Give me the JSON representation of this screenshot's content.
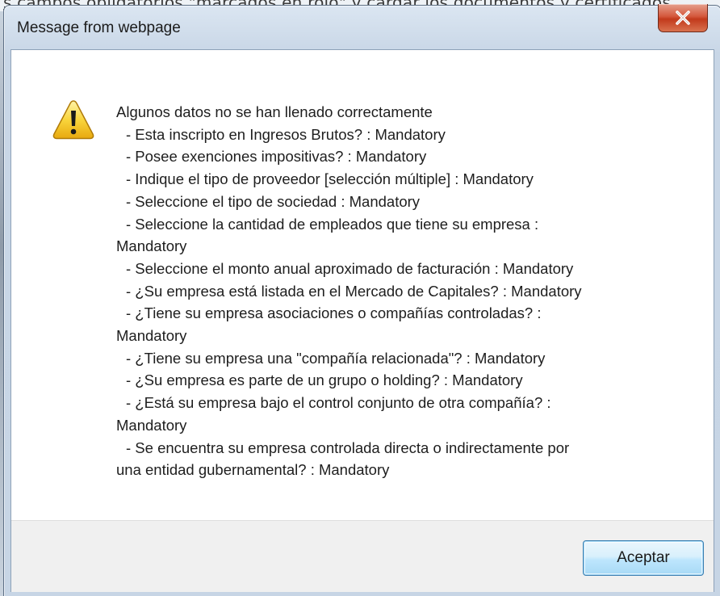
{
  "background": {
    "partial_text": "s campos obligatorios \"marcados en rojo\" y cargar los documentos y certificados"
  },
  "dialog": {
    "title": "Message from webpage",
    "close_glyph": "X",
    "icon": "warning-icon",
    "message_lines": [
      "Algunos datos no se han llenado correctamente",
      " - Esta inscripto en Ingresos Brutos? : Mandatory",
      " - Posee exenciones impositivas? : Mandatory",
      " - Indique el tipo de proveedor [selección múltiple] : Mandatory",
      " - Seleccione el tipo de sociedad : Mandatory",
      " - Seleccione la cantidad de empleados que tiene su empresa :",
      "Mandatory",
      " - Seleccione el monto anual aproximado de facturación : Mandatory",
      " - ¿Su empresa está listada en el Mercado de Capitales? : Mandatory",
      " - ¿Tiene su empresa asociaciones o compañías controladas? :",
      "Mandatory",
      " - ¿Tiene su empresa una \"compañía relacionada\"? : Mandatory",
      " - ¿Su empresa es parte de un grupo o holding? : Mandatory",
      " - ¿Está su empresa bajo el control conjunto de otra compañía? :",
      "Mandatory",
      " - Se encuentra su empresa controlada directa o indirectamente por",
      "una entidad gubernamental? : Mandatory"
    ],
    "accept_label": "Aceptar"
  },
  "colors": {
    "close_button": "#c94a2c",
    "accept_border": "#3c7fb1",
    "warning_fill": "#f5c518"
  }
}
